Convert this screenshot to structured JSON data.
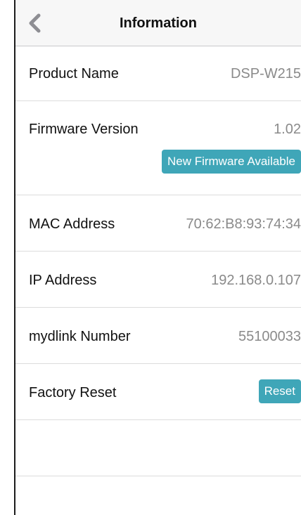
{
  "nav": {
    "title": "Information"
  },
  "rows": {
    "product_name": {
      "label": "Product Name",
      "value": "DSP-W215"
    },
    "firmware_version": {
      "label": "Firmware Version",
      "value": "1.02",
      "button": "New Firmware Available"
    },
    "mac_address": {
      "label": "MAC Address",
      "value": "70:62:B8:93:74:34"
    },
    "ip_address": {
      "label": "IP Address",
      "value": "192.168.0.107"
    },
    "mydlink_number": {
      "label": "mydlink Number",
      "value": "55100033"
    },
    "factory_reset": {
      "label": "Factory Reset",
      "button": "Reset"
    }
  },
  "colors": {
    "accent": "#3fa6b8",
    "value_text": "#8a8a8a",
    "label_text": "#111111"
  }
}
